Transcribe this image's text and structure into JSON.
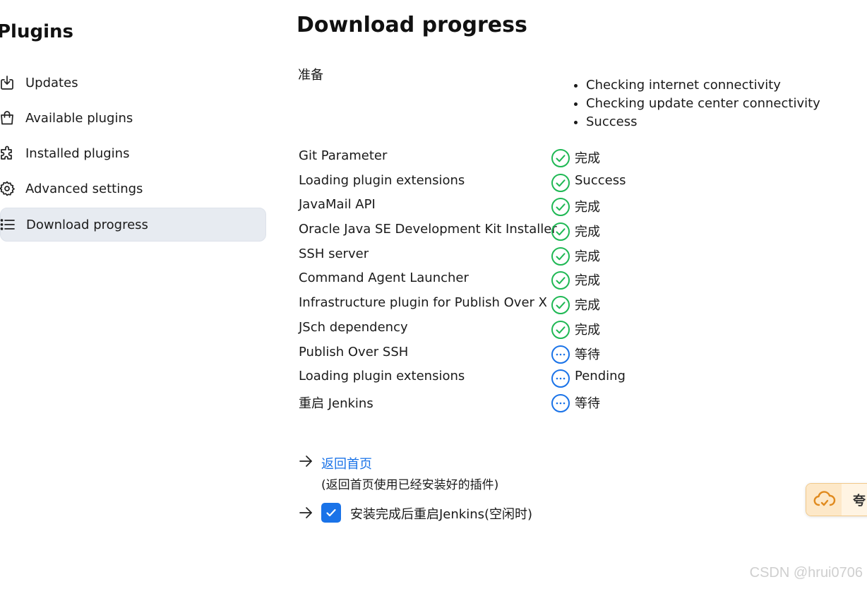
{
  "sidebar": {
    "title": "Plugins",
    "items": [
      {
        "label": "Updates",
        "icon": "download-icon"
      },
      {
        "label": "Available plugins",
        "icon": "shopping-bag-icon"
      },
      {
        "label": "Installed plugins",
        "icon": "puzzle-icon"
      },
      {
        "label": "Advanced settings",
        "icon": "gear-icon"
      },
      {
        "label": "Download progress",
        "icon": "list-icon",
        "active": true
      }
    ]
  },
  "main": {
    "title": "Download progress",
    "preparation": {
      "label": "准备",
      "checks": [
        "Checking internet connectivity",
        "Checking update center connectivity",
        "Success"
      ]
    },
    "rows": [
      {
        "name": "Git Parameter",
        "status": "完成",
        "state": "success"
      },
      {
        "name": "Loading plugin extensions",
        "status": "Success",
        "state": "success"
      },
      {
        "name": "JavaMail API",
        "status": "完成",
        "state": "success"
      },
      {
        "name": "Oracle Java SE Development Kit Installer",
        "status": "完成",
        "state": "success"
      },
      {
        "name": "SSH server",
        "status": "完成",
        "state": "success"
      },
      {
        "name": "Command Agent Launcher",
        "status": "完成",
        "state": "success"
      },
      {
        "name": "Infrastructure plugin for Publish Over X",
        "status": "完成",
        "state": "success"
      },
      {
        "name": "JSch dependency",
        "status": "完成",
        "state": "success"
      },
      {
        "name": "Publish Over SSH",
        "status": "等待",
        "state": "pending"
      },
      {
        "name": "Loading plugin extensions",
        "status": "Pending",
        "state": "pending"
      },
      {
        "name": "重启 Jenkins",
        "status": "等待",
        "state": "pending"
      }
    ],
    "home_link": "返回首页",
    "home_desc": "(返回首页使用已经安装好的插件)",
    "restart_label": "安装完成后重启Jenkins(空闲时)",
    "restart_checked": true
  },
  "float_widget": {
    "text": "夸"
  },
  "watermark": "CSDN @hrui0706",
  "colors": {
    "success": "#1fb854",
    "pending": "#1a73e8",
    "link": "#1a73e8",
    "active_bg": "#e7ebf1"
  }
}
